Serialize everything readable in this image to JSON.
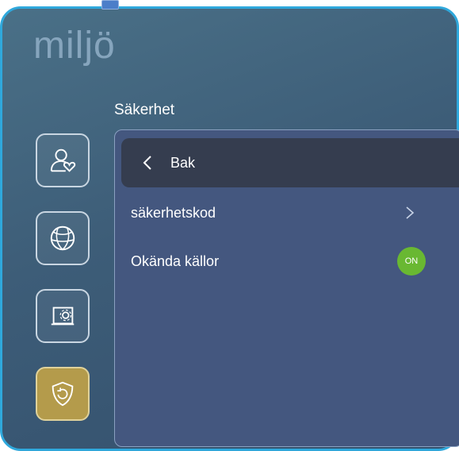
{
  "header": {
    "title": "miljö"
  },
  "section": {
    "title": "Säkerhet"
  },
  "sidebar": {
    "items": [
      {
        "name": "user-heart",
        "icon": "user-heart-icon",
        "active": false
      },
      {
        "name": "network",
        "icon": "globe-icon",
        "active": false
      },
      {
        "name": "system",
        "icon": "screen-gear-icon",
        "active": false
      },
      {
        "name": "security",
        "icon": "shield-icon",
        "active": true
      }
    ]
  },
  "panel": {
    "back_label": "Bak",
    "rows": [
      {
        "label": "säkerhetskod",
        "control": "chevron-right-icon"
      },
      {
        "label": "Okända källor",
        "control": "toggle",
        "toggle_text": "ON"
      }
    ]
  },
  "colors": {
    "accent_border": "#2fa8dc",
    "active_sidebar": "#b49b4b",
    "toggle_on": "#69b832",
    "panel_bg": "#44577f",
    "back_bar_bg": "#353d4f"
  }
}
